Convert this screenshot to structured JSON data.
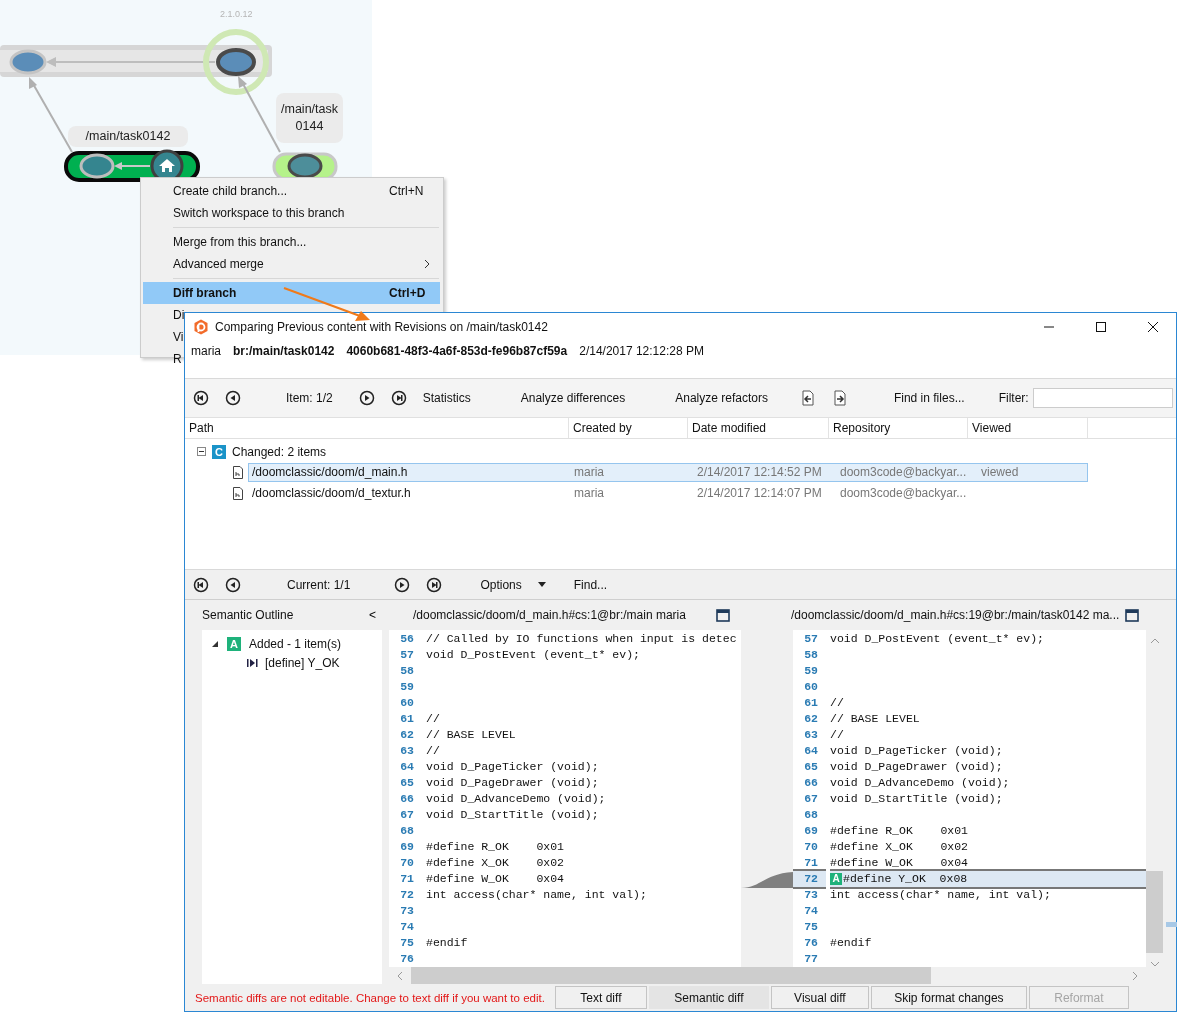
{
  "graph": {
    "tag": "2.1.0.12",
    "branches": [
      {
        "lines": [
          "/main/task0142"
        ]
      },
      {
        "lines": [
          "/main/task",
          "0144"
        ]
      }
    ]
  },
  "menu": {
    "groups": [
      {
        "items": [
          {
            "label": "Create child branch...",
            "shortcut": "Ctrl+N",
            "submenu": false,
            "bold": false,
            "selected": false
          },
          {
            "label": "Switch workspace to this branch",
            "submenu": false,
            "bold": false,
            "selected": false
          }
        ]
      },
      {
        "items": [
          {
            "label": "Merge from this branch...",
            "submenu": false,
            "bold": false,
            "selected": false
          },
          {
            "label": "Advanced merge",
            "submenu": true,
            "bold": false,
            "selected": false
          }
        ]
      },
      {
        "items": [
          {
            "label": "Diff branch",
            "shortcut": "Ctrl+D",
            "submenu": false,
            "bold": true,
            "selected": true
          },
          {
            "label": "Di",
            "bold": false,
            "selected": false
          },
          {
            "label": "Vi",
            "bold": false,
            "selected": false
          },
          {
            "label": "R",
            "bold": false,
            "selected": false
          }
        ]
      }
    ]
  },
  "window": {
    "title": "Comparing Previous content with Revisions on /main/task0142",
    "info": {
      "user": "maria",
      "branch": "br:/main/task0142",
      "changeset": "4060b681-48f3-4a6f-853d-fe96b87cf59a",
      "date": "2/14/2017 12:12:28 PM"
    },
    "toolbar": {
      "position": "Item: 1/2",
      "actions": [
        "Statistics",
        "Analyze differences",
        "Analyze refactors"
      ],
      "find": "Find in files...",
      "filter_label": "Filter:"
    },
    "table": {
      "columns": [
        "Path",
        "Created by",
        "Date modified",
        "Repository",
        "Viewed"
      ],
      "group": {
        "badge": "C",
        "label": "Changed: 2 items",
        "expanded": true
      },
      "rows": [
        {
          "path": "/doomclassic/doom/d_main.h",
          "created_by": "maria",
          "date": "2/14/2017 12:14:52 PM",
          "repository": "doom3code@backyar...",
          "viewed": "viewed",
          "selected": true
        },
        {
          "path": "/doomclassic/doom/d_textur.h",
          "created_by": "maria",
          "date": "2/14/2017 12:14:07 PM",
          "repository": "doom3code@backyar...",
          "selected": false
        }
      ]
    },
    "diff_toolbar": {
      "position": "Current: 1/1",
      "options": "Options",
      "find": "Find..."
    },
    "outline": {
      "title": "Semantic Outline",
      "collapse": "<",
      "groups": [
        {
          "badge": "A",
          "label": "Added - 1 item(s)",
          "expanded": true,
          "children": [
            {
              "label": "[define] Y_OK"
            }
          ]
        }
      ]
    },
    "left": {
      "header": "/doomclassic/doom/d_main.h#cs:1@br:/main maria",
      "lines": [
        {
          "n": "56",
          "text": "// Called by IO functions when input is detec",
          "added": false
        },
        {
          "n": "57",
          "text": "void D_PostEvent (event_t* ev);",
          "added": false
        },
        {
          "n": "58",
          "added": false
        },
        {
          "n": "59",
          "added": false
        },
        {
          "n": "60",
          "added": false
        },
        {
          "n": "61",
          "text": "//",
          "added": false
        },
        {
          "n": "62",
          "text": "// BASE LEVEL",
          "added": false
        },
        {
          "n": "63",
          "text": "//",
          "added": false
        },
        {
          "n": "64",
          "text": "void D_PageTicker (void);",
          "added": false
        },
        {
          "n": "65",
          "text": "void D_PageDrawer (void);",
          "added": false
        },
        {
          "n": "66",
          "text": "void D_AdvanceDemo (void);",
          "added": false
        },
        {
          "n": "67",
          "text": "void D_StartTitle (void);",
          "added": false
        },
        {
          "n": "68",
          "added": false
        },
        {
          "n": "69",
          "text": "#define R_OK    0x01",
          "added": false
        },
        {
          "n": "70",
          "text": "#define X_OK    0x02",
          "added": false
        },
        {
          "n": "71",
          "text": "#define W_OK    0x04",
          "added": false
        },
        {
          "n": "72",
          "text": "int access(char* name, int val);",
          "added": false
        },
        {
          "n": "73",
          "added": false
        },
        {
          "n": "74",
          "added": false
        },
        {
          "n": "75",
          "text": "#endif",
          "added": false
        },
        {
          "n": "76",
          "added": false
        }
      ]
    },
    "right": {
      "header": "/doomclassic/doom/d_main.h#cs:19@br:/main/task0142 ma...",
      "lines": [
        {
          "n": "57",
          "text": "void D_PostEvent (event_t* ev);",
          "added": false
        },
        {
          "n": "58",
          "added": false
        },
        {
          "n": "59",
          "added": false
        },
        {
          "n": "60",
          "added": false
        },
        {
          "n": "61",
          "text": "//",
          "added": false
        },
        {
          "n": "62",
          "text": "// BASE LEVEL",
          "added": false
        },
        {
          "n": "63",
          "text": "//",
          "added": false
        },
        {
          "n": "64",
          "text": "void D_PageTicker (void);",
          "added": false
        },
        {
          "n": "65",
          "text": "void D_PageDrawer (void);",
          "added": false
        },
        {
          "n": "66",
          "text": "void D_AdvanceDemo (void);",
          "added": false
        },
        {
          "n": "67",
          "text": "void D_StartTitle (void);",
          "added": false
        },
        {
          "n": "68",
          "added": false
        },
        {
          "n": "69",
          "text": "#define R_OK    0x01",
          "added": false
        },
        {
          "n": "70",
          "text": "#define X_OK    0x02",
          "added": false
        },
        {
          "n": "71",
          "text": "#define W_OK    0x04",
          "added": false
        },
        {
          "n": "72",
          "text": "#define Y_OK  0x08",
          "added": true,
          "badge": "A"
        },
        {
          "n": "73",
          "text": "int access(char* name, int val);",
          "added": false
        },
        {
          "n": "74",
          "added": false
        },
        {
          "n": "75",
          "added": false
        },
        {
          "n": "76",
          "text": "#endif",
          "added": false
        },
        {
          "n": "77",
          "added": false
        }
      ]
    },
    "status_message": "Semantic diffs are not editable. Change to text diff if you want to edit.",
    "buttons": [
      {
        "label": "Text diff",
        "selected": false,
        "disabled": false
      },
      {
        "label": "Semantic diff",
        "selected": true,
        "disabled": false
      },
      {
        "label": "Visual diff",
        "selected": false,
        "disabled": false
      },
      {
        "label": "Skip format changes",
        "selected": false,
        "disabled": false
      },
      {
        "label": "Reformat",
        "selected": false,
        "disabled": true
      }
    ]
  }
}
